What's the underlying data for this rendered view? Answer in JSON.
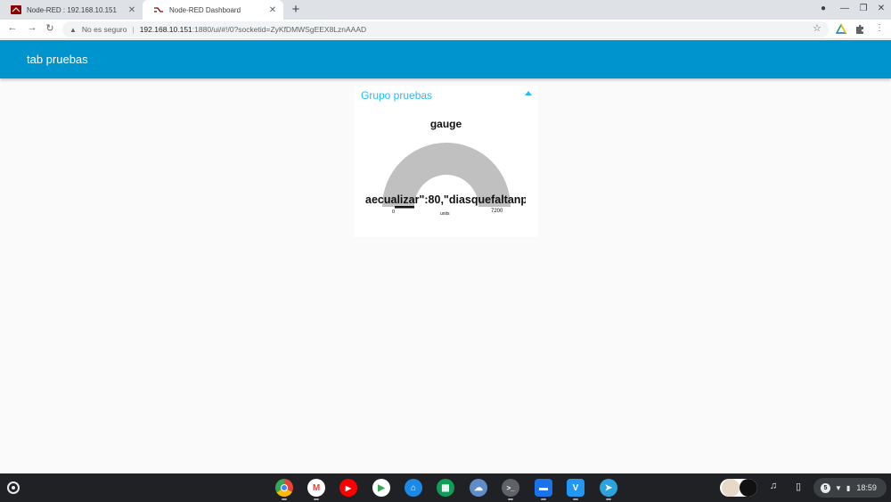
{
  "browser": {
    "tabs": [
      {
        "title": "Node-RED : 192.168.10.151",
        "close": "✕"
      },
      {
        "title": "Node-RED Dashboard",
        "close": "✕"
      }
    ],
    "new_tab": "+",
    "window_controls": {
      "profile": "●",
      "minimize": "—",
      "restore": "❐",
      "close": "✕"
    },
    "nav": {
      "back": "←",
      "forward": "→",
      "reload": "↻"
    },
    "address": {
      "warning_icon": "▲",
      "security_text": "No es seguro",
      "separator": "|",
      "host": "192.168.10.151",
      "path": ":1880/ui/#!/0?socketid=ZyKfDMWSgEEX8LznAAAD"
    },
    "bookmark_icon": "☆",
    "extension_icon": "puzzle-icon",
    "menu_icon": "⋮"
  },
  "dashboard": {
    "header_title": "tab pruebas",
    "header_color": "#0094ce",
    "group": {
      "title": "Grupo pruebas",
      "accent": "#1bbfff",
      "gauge": {
        "title": "gauge",
        "value_text": "aecualizar\":80,\"diasquefaltanp",
        "min": "0",
        "max": "7200",
        "units": "units",
        "arc_color": "#c0c0c0"
      }
    }
  },
  "shelf": {
    "apps": [
      {
        "name": "chrome",
        "glyph": "",
        "color": "#4285f4"
      },
      {
        "name": "gmail",
        "glyph": "M",
        "color": "#ffffff"
      },
      {
        "name": "youtube",
        "glyph": "▶",
        "color": "#ff0000"
      },
      {
        "name": "play-store",
        "glyph": "▶",
        "color": "#ffffff"
      },
      {
        "name": "home",
        "glyph": "⌂",
        "color": "#1e88e5"
      },
      {
        "name": "apps-grid",
        "glyph": "▦",
        "color": "#0f9d58"
      },
      {
        "name": "weather",
        "glyph": "☁",
        "color": "#5f8dc9"
      },
      {
        "name": "terminal",
        "glyph": ">_",
        "color": "#3c4043"
      },
      {
        "name": "files",
        "glyph": "▬",
        "color": "#1a73e8"
      },
      {
        "name": "vscode-app",
        "glyph": "V",
        "color": "#2196f3"
      },
      {
        "name": "telegram",
        "glyph": "➤",
        "color": "#2aa3df"
      }
    ],
    "tray": {
      "notifications": "5",
      "wifi": "▼",
      "battery": "▮",
      "time": "18:59"
    }
  }
}
